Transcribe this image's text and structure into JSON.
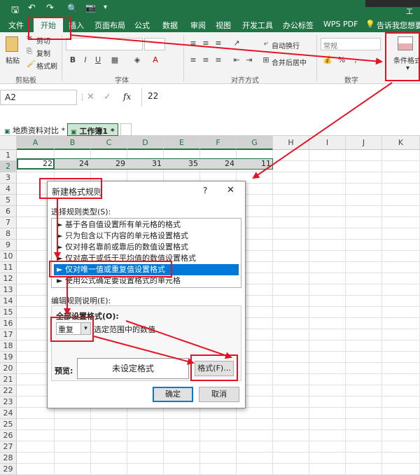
{
  "title_bar": {
    "right_text": "工"
  },
  "menu": {
    "items": [
      "文件",
      "开始",
      "插入",
      "页面布局",
      "公式",
      "数据",
      "审阅",
      "视图",
      "开发工具",
      "办公标签",
      "WPS PDF",
      "告诉我您想要做什么"
    ],
    "active_index": 1
  },
  "ribbon": {
    "clipboard": {
      "paste": "粘贴",
      "cut": "剪切",
      "copy": "复制",
      "format_painter": "格式刷",
      "group_label": "剪贴板"
    },
    "font": {
      "group_label": "字体"
    },
    "alignment": {
      "wrap": "自动换行",
      "merge": "合并后居中",
      "group_label": "对齐方式"
    },
    "number": {
      "format": "常规",
      "group_label": "数字"
    },
    "styles": {
      "conditional_format": "条件格式"
    }
  },
  "formula_bar": {
    "name_box": "A2",
    "fx": "fx",
    "value": "22"
  },
  "sheet_tabs": [
    {
      "label": "地质资料对比 *"
    },
    {
      "label": "工作簿1 *"
    }
  ],
  "columns": [
    "A",
    "B",
    "C",
    "D",
    "E",
    "F",
    "G",
    "H",
    "I",
    "J",
    "K"
  ],
  "rows": [
    "1",
    "2",
    "3",
    "4",
    "5",
    "6",
    "7",
    "8",
    "9",
    "10",
    "11",
    "12",
    "13",
    "14",
    "15",
    "16",
    "17",
    "18",
    "19",
    "20",
    "21",
    "22",
    "23",
    "24",
    "25",
    "26",
    "27",
    "28",
    "29"
  ],
  "row2_values": [
    "22",
    "24",
    "29",
    "31",
    "35",
    "24",
    "11"
  ],
  "dialog": {
    "title": "新建格式规则",
    "help": "?",
    "close": "✕",
    "select_type_label": "选择规则类型(S):",
    "rules": [
      "► 基于各自值设置所有单元格的格式",
      "► 只为包含以下内容的单元格设置格式",
      "► 仅对排名靠前或靠后的数值设置格式",
      "► 仅对高于或低于平均值的数值设置格式",
      "► 仅对唯一值或重复值设置格式",
      "► 使用公式确定要设置格式的单元格"
    ],
    "selected_rule_index": 4,
    "edit_desc_label": "编辑规则说明(E):",
    "format_all_label": "全部设置格式(O):",
    "dropdown_value": "重复",
    "dropdown_suffix": "选定范围中的数值",
    "preview_label": "预览:",
    "preview_text": "未设定格式",
    "format_button": "格式(F)...",
    "ok_button": "确定",
    "cancel_button": "取消"
  },
  "colors": {
    "excel_green": "#217346",
    "highlight_red": "#e81123",
    "selection_blue": "#0078d7"
  }
}
